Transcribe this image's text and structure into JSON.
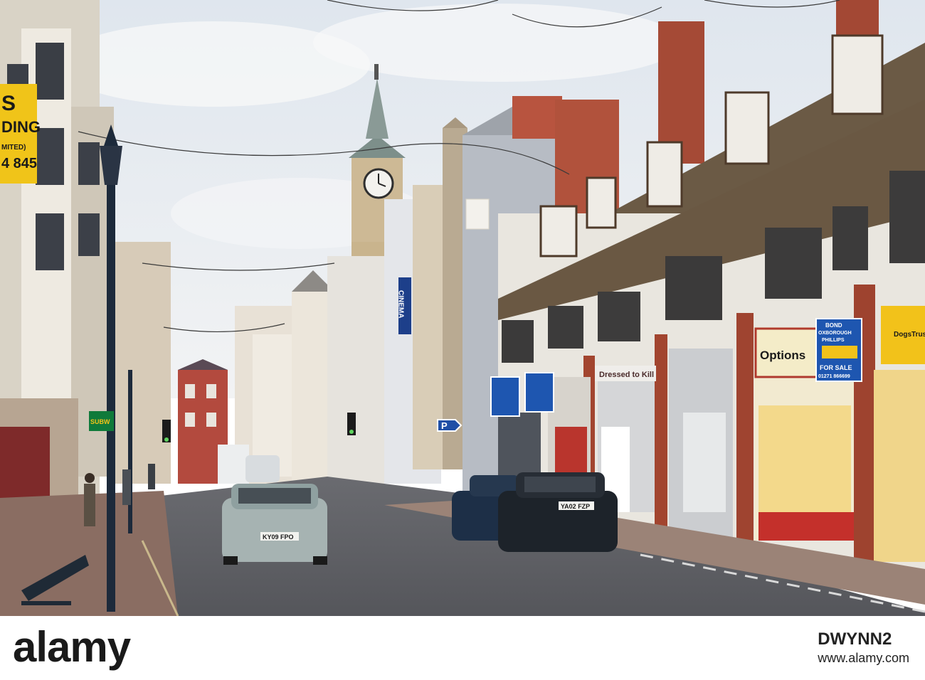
{
  "image": {
    "description_visible_text": {
      "left_sign_line1": "S",
      "left_sign_line2": "DING",
      "left_sign_line3": "MITED)",
      "left_sign_phone": "4 845",
      "cinema_sign": "CINEMA",
      "parking_sign": "P",
      "shop_dressed": "Dressed to Kill",
      "shop_options": "Options",
      "shop_dogs": "DogsTrust",
      "agent_sign_line1": "BOND",
      "agent_sign_line2": "OXBOROUGH",
      "agent_sign_line3": "PHILLIPS",
      "for_sale": "FOR SALE",
      "agent_phone": "01271 866699",
      "car_plate_front": "KY09 FPO",
      "car_plate_parked": "YA02 FZP",
      "subway_sign": "SUBW"
    }
  },
  "watermark": {
    "brand": "alamy",
    "stock_code": "DWYNN2",
    "url": "www.alamy.com"
  }
}
